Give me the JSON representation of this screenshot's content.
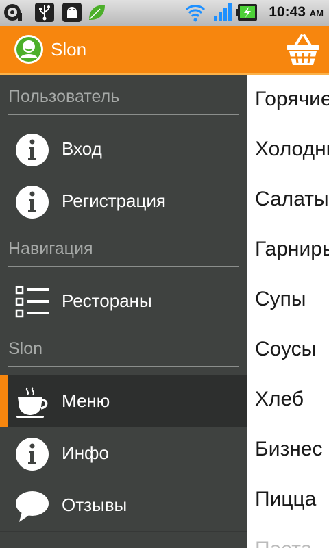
{
  "status_bar": {
    "time": "10:43",
    "ampm": "AM",
    "icons": [
      "music-notification-icon",
      "usb-icon",
      "android-debug-icon",
      "leaf-icon",
      "wifi-icon",
      "signal-icon",
      "battery-charging-icon"
    ]
  },
  "action_bar": {
    "title": "Slon",
    "logo_icon": "user-avatar-icon",
    "cart_icon": "basket-icon"
  },
  "drawer": {
    "sections": [
      {
        "title": "Пользователь",
        "items": [
          {
            "label": "Вход",
            "icon": "info-icon"
          },
          {
            "label": "Регистрация",
            "icon": "info-icon"
          }
        ]
      },
      {
        "title": "Навигация",
        "items": [
          {
            "label": "Рестораны",
            "icon": "list-icon"
          }
        ]
      },
      {
        "title": "Slon",
        "items": [
          {
            "label": "Меню",
            "icon": "coffee-cup-icon",
            "selected": true
          },
          {
            "label": "Инфо",
            "icon": "info-icon"
          },
          {
            "label": "Отзывы",
            "icon": "speech-bubble-icon"
          }
        ]
      }
    ]
  },
  "main": {
    "categories": [
      "Горячие",
      "Холодные",
      "Салаты",
      "Гарниры",
      "Супы",
      "Соусы",
      "Хлеб",
      "Бизнес",
      "Пицца",
      "Паста"
    ]
  },
  "colors": {
    "accent": "#f7860e",
    "drawer_bg": "#3f4240",
    "drawer_selected": "#2d2f2e",
    "section_text": "#a6a9a7"
  }
}
